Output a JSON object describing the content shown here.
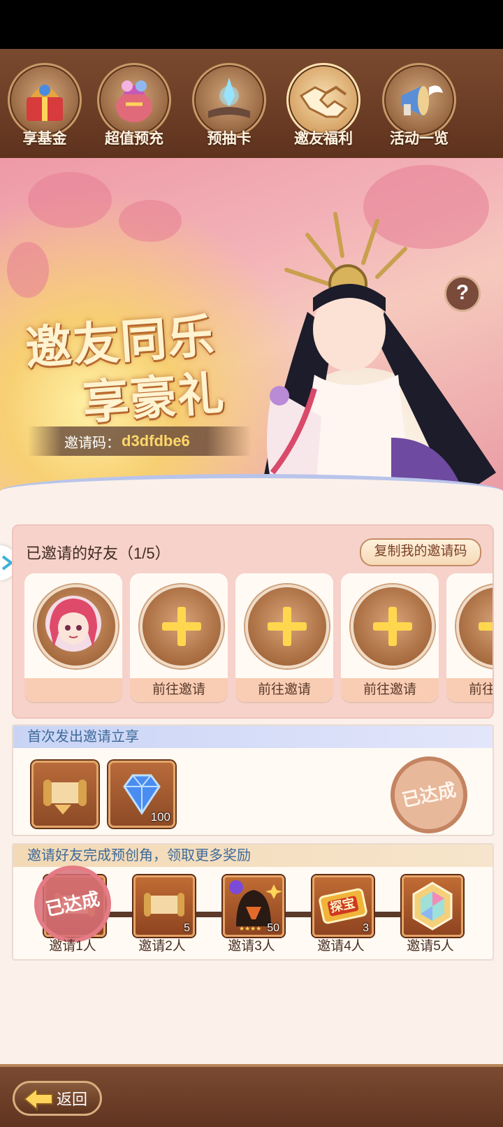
{
  "tabs": [
    {
      "label": "享基金",
      "active": false,
      "icon": "gift-fund-icon"
    },
    {
      "label": "超值预充",
      "active": false,
      "icon": "gift-bag-icon"
    },
    {
      "label": "预抽卡",
      "active": false,
      "icon": "book-crystal-icon"
    },
    {
      "label": "邀友福利",
      "active": true,
      "icon": "handshake-icon"
    },
    {
      "label": "活动一览",
      "active": false,
      "icon": "megaphone-icon"
    }
  ],
  "banner": {
    "title_line1": "邀友同乐",
    "title_line2": "享豪礼",
    "invite_code_label": "邀请码：",
    "invite_code": "d3dfdbe6",
    "help_symbol": "?"
  },
  "friends": {
    "title": "已邀请的好友（1/5）",
    "copy_button": "复制我的邀请码",
    "slots": [
      {
        "state": "invited",
        "label": ""
      },
      {
        "state": "empty",
        "label": "前往邀请"
      },
      {
        "state": "empty",
        "label": "前往邀请"
      },
      {
        "state": "empty",
        "label": "前往邀请"
      },
      {
        "state": "empty",
        "label": "前往邀请"
      }
    ]
  },
  "first_invite": {
    "title": "首次发出邀请立享",
    "items": [
      {
        "icon": "scroll-icon",
        "qty": ""
      },
      {
        "icon": "diamond-icon",
        "qty": "100"
      }
    ],
    "stamp": "已达成"
  },
  "more_rewards": {
    "title": "邀请好友完成预创角，领取更多奖励",
    "steps": [
      {
        "label": "邀请1人",
        "icon": "scroll-icon",
        "qty": "",
        "stamp": "已达成"
      },
      {
        "label": "邀请2人",
        "icon": "scroll-icon",
        "qty": "5",
        "stamp": ""
      },
      {
        "label": "邀请3人",
        "icon": "character-icon",
        "qty": "50",
        "stamp": ""
      },
      {
        "label": "邀请4人",
        "icon": "treasure-ticket-icon",
        "qty": "3",
        "stamp": ""
      },
      {
        "label": "邀请5人",
        "icon": "rainbow-crystal-icon",
        "qty": "",
        "stamp": ""
      }
    ],
    "ticket_text": "探宝"
  },
  "footer": {
    "back_label": "返回"
  },
  "colors": {
    "accent_gold": "#ffd74f",
    "panel_pink": "#f6d2cb",
    "header_blue_text": "#3e6a99",
    "invite_code": "#ffd86a"
  }
}
